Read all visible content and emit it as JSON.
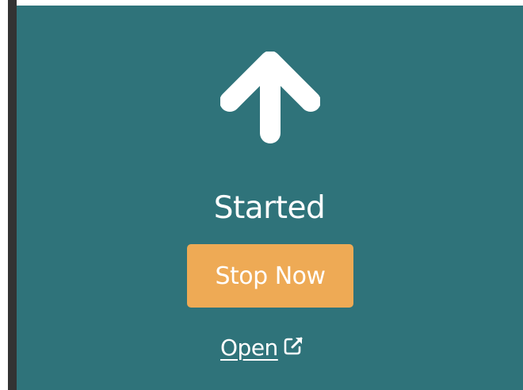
{
  "colors": {
    "panel_background": "#2f737a",
    "button_background": "#eeaa55",
    "text": "#ffffff",
    "left_bar": "#333333"
  },
  "status": {
    "icon": "arrow-up-icon",
    "text": "Started"
  },
  "stop_button": {
    "label": "Stop Now"
  },
  "open_link": {
    "label": "Open",
    "icon": "external-link-icon"
  }
}
